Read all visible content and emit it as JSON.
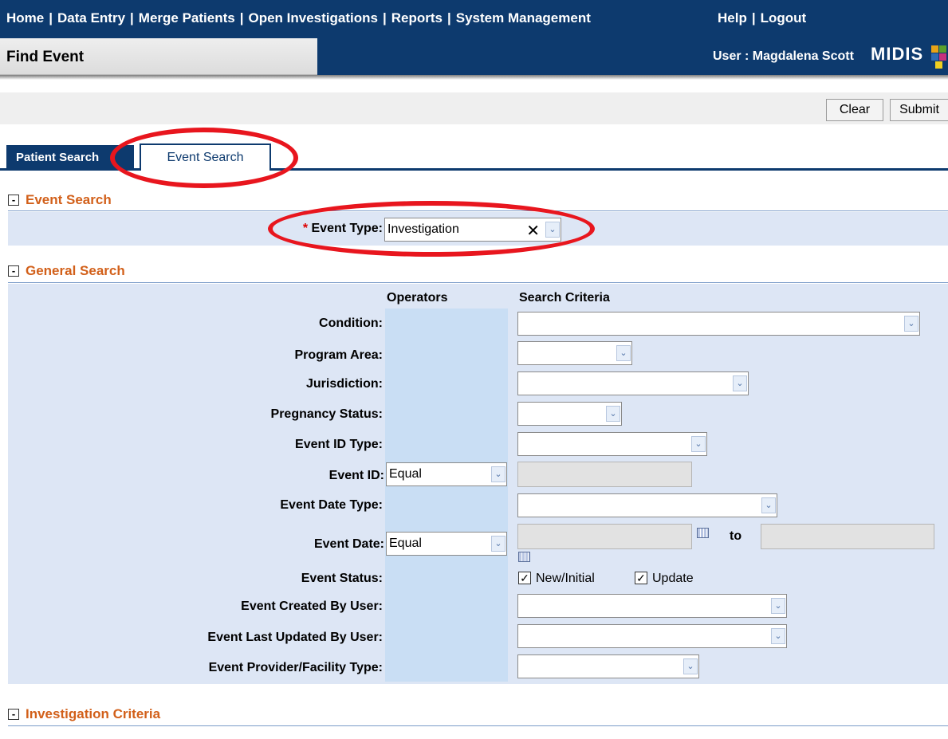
{
  "nav": {
    "items": [
      {
        "label": "Home"
      },
      {
        "label": "Data Entry"
      },
      {
        "label": "Merge Patients"
      },
      {
        "label": "Open Investigations"
      },
      {
        "label": "Reports"
      },
      {
        "label": "System Management"
      }
    ],
    "help": "Help",
    "logout": "Logout",
    "separator": "|"
  },
  "header": {
    "page_title": "Find Event",
    "user": "User : Magdalena Scott",
    "logo_text": "MIDIS"
  },
  "actions": {
    "clear": "Clear",
    "submit": "Submit"
  },
  "tabs": [
    {
      "label": "Patient Search",
      "active": false
    },
    {
      "label": "Event Search",
      "active": true
    }
  ],
  "event_search": {
    "title": "Event Search",
    "required_mark": "*",
    "event_type_label": "Event Type:",
    "event_type_value": "Investigation"
  },
  "general_search": {
    "title": "General Search",
    "operators_header": "Operators",
    "criteria_header": "Search Criteria",
    "labels": {
      "condition": "Condition:",
      "program_area": "Program Area:",
      "jurisdiction": "Jurisdiction:",
      "pregnancy_status": "Pregnancy Status:",
      "event_id_type": "Event ID Type:",
      "event_id": "Event ID:",
      "event_date_type": "Event Date Type:",
      "event_date": "Event Date:",
      "event_status": "Event Status:",
      "created_by": "Event Created By User:",
      "updated_by": "Event Last Updated By User:",
      "provider_type": "Event Provider/Facility Type:"
    },
    "event_id_operator": "Equal",
    "event_date_operator": "Equal",
    "to_label": "to",
    "status_options": [
      {
        "label": "New/Initial",
        "checked": true
      },
      {
        "label": "Update",
        "checked": true
      }
    ]
  },
  "investigation_criteria": {
    "title": "Investigation Criteria"
  },
  "collapse_symbol": "-",
  "arrow_glyph": "⌄",
  "check_glyph": "✓",
  "clear_glyph": "✕",
  "colors": {
    "nav_bg": "#0d3a6e",
    "section_title": "#d2601a",
    "panel_bg": "#dde6f5",
    "annotation_oval": "#e8161e"
  }
}
